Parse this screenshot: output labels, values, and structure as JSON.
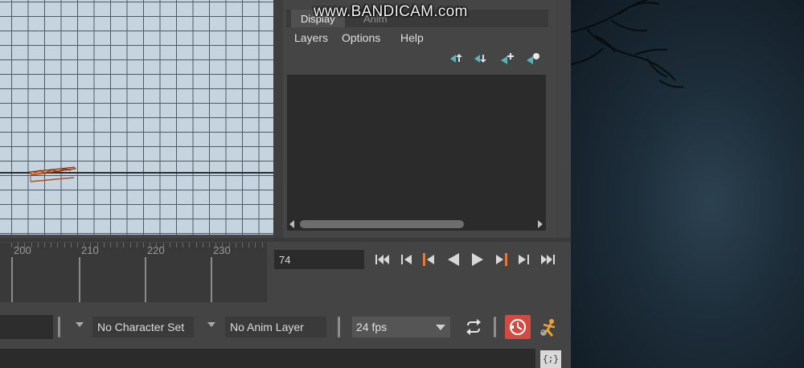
{
  "watermark": "www.BANDICAM.com",
  "tabs": [
    {
      "label": "Display",
      "active": true
    },
    {
      "label": "Anim",
      "active": false
    }
  ],
  "menu": [
    "Layers",
    "Options",
    "Help"
  ],
  "layer_tools": [
    "move-layer-up-icon",
    "move-layer-down-icon",
    "new-layer-icon",
    "new-layer-from-selected-icon"
  ],
  "time_slider": {
    "ticks": [
      {
        "label": "200"
      },
      {
        "label": "210"
      },
      {
        "label": "220"
      },
      {
        "label": "230"
      }
    ]
  },
  "current_frame": "74",
  "playback_buttons": [
    "go-to-start-icon",
    "step-back-frame-icon",
    "step-back-key-icon",
    "play-backwards-icon",
    "play-forwards-icon",
    "step-forward-key-icon",
    "step-forward-frame-icon",
    "go-to-end-icon"
  ],
  "bottom_bar": {
    "character_set": "No Character Set",
    "anim_layer": "No Anim Layer",
    "fps": "24 fps"
  },
  "script_editor_label": "{;}",
  "colors": {
    "maya_bg": "#444444",
    "viewport_bg": "#c6d4e0",
    "grid_line": "#4b5b6a",
    "key_orange": "#e07a3a",
    "autokey_red": "#d24a41"
  }
}
